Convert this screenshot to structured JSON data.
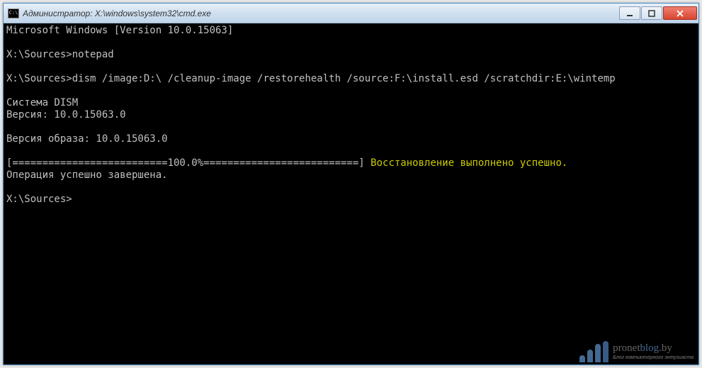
{
  "titlebar": {
    "icon_text": "C:\\",
    "title": "Администратор: X:\\windows\\system32\\cmd.exe"
  },
  "terminal": {
    "line_version": "Microsoft Windows [Version 10.0.15063]",
    "prompt1": "X:\\Sources>",
    "cmd1": "notepad",
    "prompt2": "X:\\Sources>",
    "cmd2": "dism /image:D:\\ /cleanup-image /restorehealth /source:F:\\install.esd /scratchdir:E:\\wintemp",
    "dism_header": "Cистема DISM",
    "dism_version": "Версия: 10.0.15063.0",
    "image_version": "Версия образа: 10.0.15063.0",
    "progress_bar": "[==========================100.0%==========================] ",
    "progress_status": "Восстановление выполнено успешно.",
    "completion": "Операция успешно завершена.",
    "prompt3": "X:\\Sources>"
  },
  "watermark": {
    "main_a": "pronet",
    "main_b": "blog",
    "main_c": ".by",
    "sub": "Блог компьютерного энтузиаста"
  }
}
